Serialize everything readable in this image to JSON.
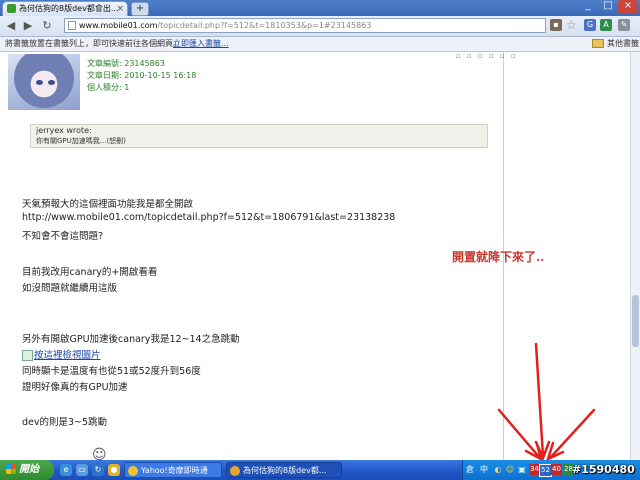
{
  "browser": {
    "tab_title": "為何估狗的8版dev都會出...",
    "tab_close": "×",
    "new_tab": "+",
    "window_min": "_",
    "window_max": "□",
    "window_close": "×",
    "url_domain": "www.mobile01.com",
    "url_rest": "/topicdetail.php?f=512&t=1810353&p=1#23145863",
    "bookmark_message": "將書籤放置在書籤列上，即可快速前往各個網頁。",
    "bookmark_link": "立即匯入書籤...",
    "other_bookmarks": "其他書籤"
  },
  "post": {
    "article_id": "文章編號: 23145863",
    "article_date": "文章日期: 2010-10-15 16:18",
    "points": "個人積分: 1",
    "action_icons": "▫ ▫ ▫ ▫ ▫ ▫",
    "quote_author": "jerryex wrote:",
    "quote_text": "你有關GPU加速嗎我...(恕刪)",
    "lines": [
      "天氣預報大的這個裡面功能我是都全開啟",
      "http://www.mobile01.com/topicdetail.php?f=512&t=1806791&last=23138238",
      "不知會不會這問題?",
      "目前我改用canary的+開啟看看",
      "如沒問題就繼續用這版",
      "另外有開啟GPU加速後canary我是12~14之急跳動",
      "同時顯卡是溫度有也從51或52度升到56度",
      "證明好像真的有GPU加速",
      "dev的則是3~5跳動"
    ],
    "image_link": "按這裡檢視圖片",
    "annotation": "開置就降下來了..",
    "smiley": "☺"
  },
  "taskbar": {
    "start_label": "開始",
    "task1": "Yahoo!奇摩即時通",
    "task2": "為何估狗的8版dev都...",
    "tray_ime": "倉",
    "tray_lang": "中",
    "temps": [
      "34",
      "52",
      "40",
      "28"
    ],
    "watermark": "#1590480"
  },
  "colors": {
    "accent_green": "#2b7f2b",
    "link_blue": "#1a47a8",
    "annotation_red": "#c9362e",
    "arrow_red": "#e3211b"
  }
}
